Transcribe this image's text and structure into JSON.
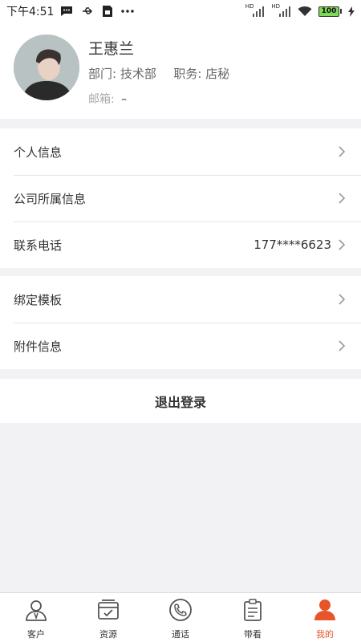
{
  "status_bar": {
    "time": "下午4:51",
    "battery": "100",
    "signal_label": "HD"
  },
  "profile": {
    "name": "王惠兰",
    "department_label": "部门:",
    "department": "技术部",
    "position_label": "职务:",
    "position": "店秘",
    "email_label": "邮箱:",
    "email": "–"
  },
  "group1": [
    {
      "label": "个人信息",
      "value": ""
    },
    {
      "label": "公司所属信息",
      "value": ""
    },
    {
      "label": "联系电话",
      "value": "177****6623"
    }
  ],
  "group2": [
    {
      "label": "绑定模板",
      "value": ""
    },
    {
      "label": "附件信息",
      "value": ""
    }
  ],
  "logout_label": "退出登录",
  "tabs": [
    {
      "label": "客户",
      "icon": "customer-icon",
      "active": false
    },
    {
      "label": "资源",
      "icon": "resource-icon",
      "active": false
    },
    {
      "label": "通话",
      "icon": "phone-icon",
      "active": false
    },
    {
      "label": "带看",
      "icon": "clipboard-icon",
      "active": false
    },
    {
      "label": "我的",
      "icon": "profile-icon",
      "active": true
    }
  ],
  "colors": {
    "accent": "#e8552a",
    "background": "#f2f2f4"
  }
}
